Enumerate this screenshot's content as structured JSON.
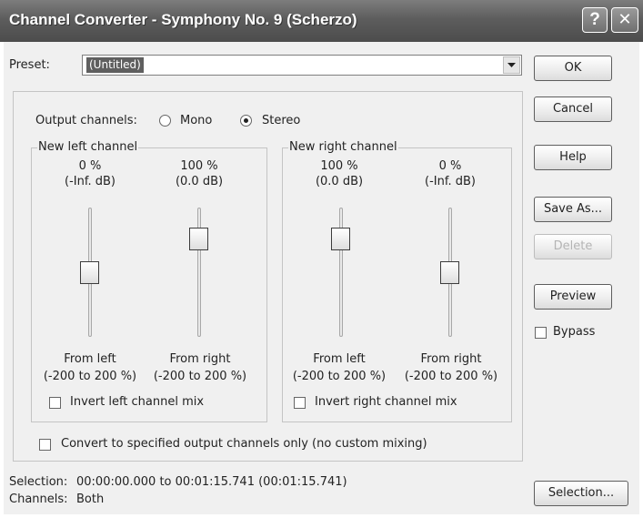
{
  "window": {
    "title": "Channel Converter - Symphony No. 9 (Scherzo)",
    "help_glyph": "?",
    "close_glyph": "✕"
  },
  "preset": {
    "label": "Preset:",
    "value": "(Untitled)"
  },
  "output": {
    "label": "Output channels:",
    "mono": "Mono",
    "stereo": "Stereo",
    "selected": "Stereo"
  },
  "left_group": {
    "title": "New left channel",
    "sliders": [
      {
        "pct": "0 %",
        "db": "(-Inf. dB)",
        "from": "From left",
        "range": "(-200 to 200 %)",
        "level_percent": 0
      },
      {
        "pct": "100 %",
        "db": "(0.0 dB)",
        "from": "From right",
        "range": "(-200 to 200 %)",
        "level_percent": 100
      }
    ],
    "invert_label": "Invert left channel mix",
    "invert_checked": false
  },
  "right_group": {
    "title": "New right channel",
    "sliders": [
      {
        "pct": "100 %",
        "db": "(0.0 dB)",
        "from": "From left",
        "range": "(-200 to 200 %)",
        "level_percent": 100
      },
      {
        "pct": "0 %",
        "db": "(-Inf. dB)",
        "from": "From right",
        "range": "(-200 to 200 %)",
        "level_percent": 0
      }
    ],
    "invert_label": "Invert right channel mix",
    "invert_checked": false
  },
  "convert_only": {
    "label": "Convert to specified output channels only (no custom mixing)",
    "checked": false
  },
  "buttons": {
    "ok": "OK",
    "cancel": "Cancel",
    "help": "Help",
    "save_as": "Save As...",
    "delete": "Delete",
    "preview": "Preview",
    "selection": "Selection..."
  },
  "bypass": {
    "label": "Bypass",
    "checked": false
  },
  "status": {
    "selection_label": "Selection:",
    "selection_value": "00:00:00.000 to 00:01:15.741 (00:01:15.741)",
    "channels_label": "Channels:",
    "channels_value": "Both"
  },
  "colors": {
    "titlebar": "#5d5d5d",
    "dialog_bg": "#f0f0f0",
    "selected_value_bg": "#5f5f5f"
  },
  "icons": {
    "help": "help-icon",
    "close": "close-icon",
    "dropdown": "chevron-down-icon"
  }
}
